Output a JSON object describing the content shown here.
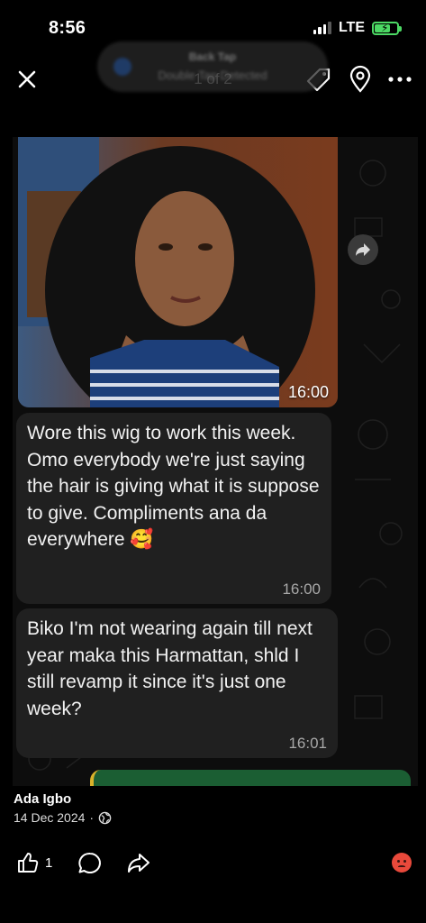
{
  "status_bar": {
    "time": "8:56",
    "network": "LTE",
    "signal_bars": 3,
    "battery_level": 0.7,
    "battery_color": "#4cd964"
  },
  "header": {
    "close_icon": "close-icon",
    "notification": {
      "title": "Back Tap",
      "subtitle": "Double Tap Detected"
    },
    "counter": "1 of 2",
    "icons": [
      "tag-icon",
      "location-pin-icon",
      "more-icon"
    ]
  },
  "chat": {
    "photo": {
      "timestamp": "16:00"
    },
    "forward_icon": "forward-icon",
    "messages": [
      {
        "text": "Wore this wig to work this week. Omo everybody we're just saying the hair is giving what it is suppose to give. Compliments ana da everywhere 🥰",
        "time": "16:00"
      },
      {
        "text": "Biko I'm not wearing again till next year maka this Harmattan, shld I still revamp it since it's just one week?",
        "time": "16:01"
      }
    ]
  },
  "post": {
    "author": "Ada Igbo",
    "date": "14 Dec 2024",
    "separator": "·",
    "visibility_icon": "globe-icon",
    "like_count": "1",
    "action_icons": [
      "like-icon",
      "comment-icon",
      "share-icon"
    ],
    "reaction_icon": "angry-reaction-icon",
    "colors": {
      "bubble": "#202020",
      "reaction": "#e8493b",
      "green_message": "#1b5e33"
    }
  }
}
